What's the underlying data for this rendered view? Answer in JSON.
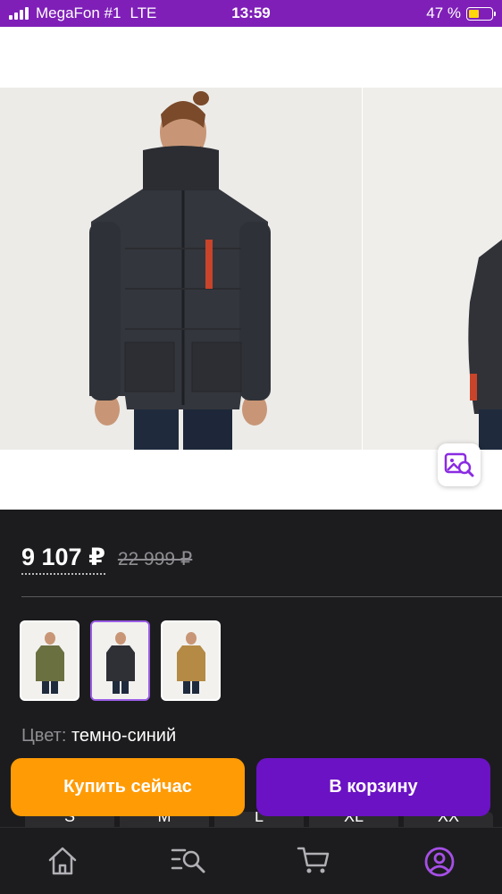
{
  "status_bar": {
    "carrier": "MegaFon #1",
    "network": "LTE",
    "time": "13:59",
    "battery_percent": "47 %",
    "battery_level": 0.47
  },
  "product": {
    "price_current": "9 107 ₽",
    "price_old": "22 999 ₽",
    "color_label": "Цвет:",
    "color_value": "темно-синий",
    "thumbnails": [
      {
        "color": "#6b7040",
        "selected": false
      },
      {
        "color": "#2e3036",
        "selected": true
      },
      {
        "color": "#b48a45",
        "selected": false
      }
    ],
    "sizes": [
      "S",
      "M",
      "L",
      "XL",
      "XX"
    ]
  },
  "actions": {
    "buy_now_label": "Купить сейчас",
    "add_to_cart_label": "В корзину"
  },
  "colors": {
    "brand": "#7f1fb8",
    "buy_now": "#ff9b05",
    "cart": "#6b12c4",
    "selected_thumb_border": "#9b5de5"
  },
  "tabbar": {
    "items": [
      {
        "icon": "home-icon",
        "active": false
      },
      {
        "icon": "catalog-search-icon",
        "active": false
      },
      {
        "icon": "cart-icon",
        "active": false
      },
      {
        "icon": "profile-icon",
        "active": true
      }
    ]
  }
}
